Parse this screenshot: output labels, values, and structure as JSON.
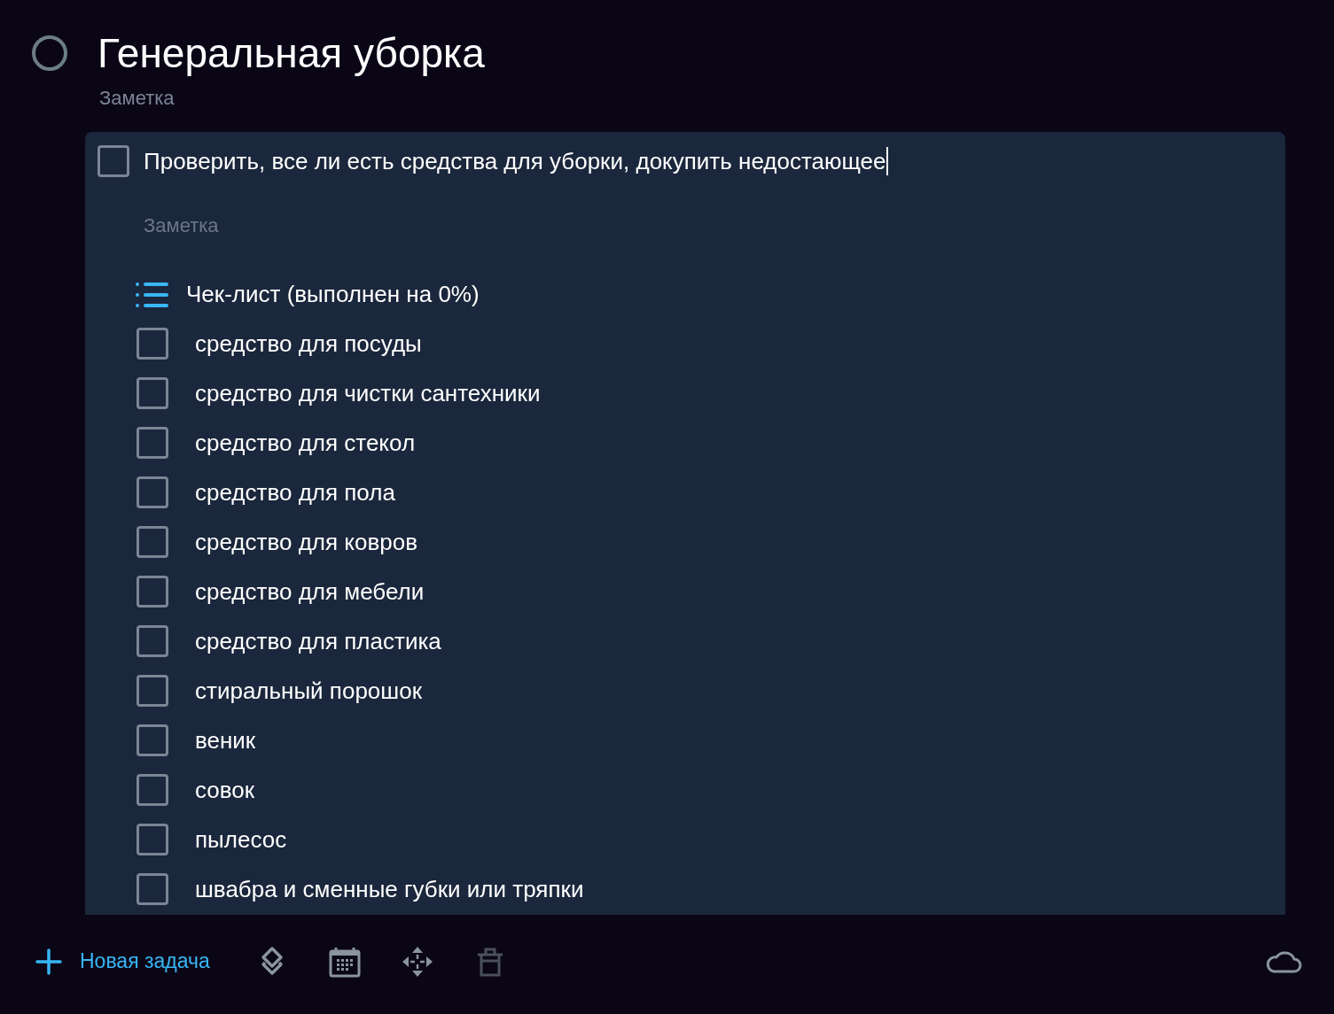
{
  "header": {
    "title": "Генеральная уборка",
    "completed": false,
    "note_placeholder": "Заметка"
  },
  "task": {
    "title": "Проверить, все ли есть средства для уборки, докупить недостающее",
    "checked": false,
    "editing": true,
    "note_placeholder": "Заметка",
    "checklist": {
      "title": "Чек-лист (выполнен на 0%)",
      "items": [
        {
          "label": "средство для посуды",
          "checked": false
        },
        {
          "label": "средство для чистки сантехники",
          "checked": false
        },
        {
          "label": "средство для стекол",
          "checked": false
        },
        {
          "label": "средство для пола",
          "checked": false
        },
        {
          "label": "средство для ковров",
          "checked": false
        },
        {
          "label": "средство для мебели",
          "checked": false
        },
        {
          "label": "средство для пластика",
          "checked": false
        },
        {
          "label": "стиральный порошок",
          "checked": false
        },
        {
          "label": "веник",
          "checked": false
        },
        {
          "label": "совок",
          "checked": false
        },
        {
          "label": "пылесос",
          "checked": false
        },
        {
          "label": "швабра и сменные губки или тряпки",
          "checked": false
        }
      ]
    }
  },
  "toolbar": {
    "new_task": "Новая задача",
    "tools": [
      {
        "kind": "layers",
        "disabled": false
      },
      {
        "kind": "calendar",
        "disabled": false
      },
      {
        "kind": "move",
        "disabled": false
      },
      {
        "kind": "trash",
        "disabled": true
      }
    ]
  }
}
